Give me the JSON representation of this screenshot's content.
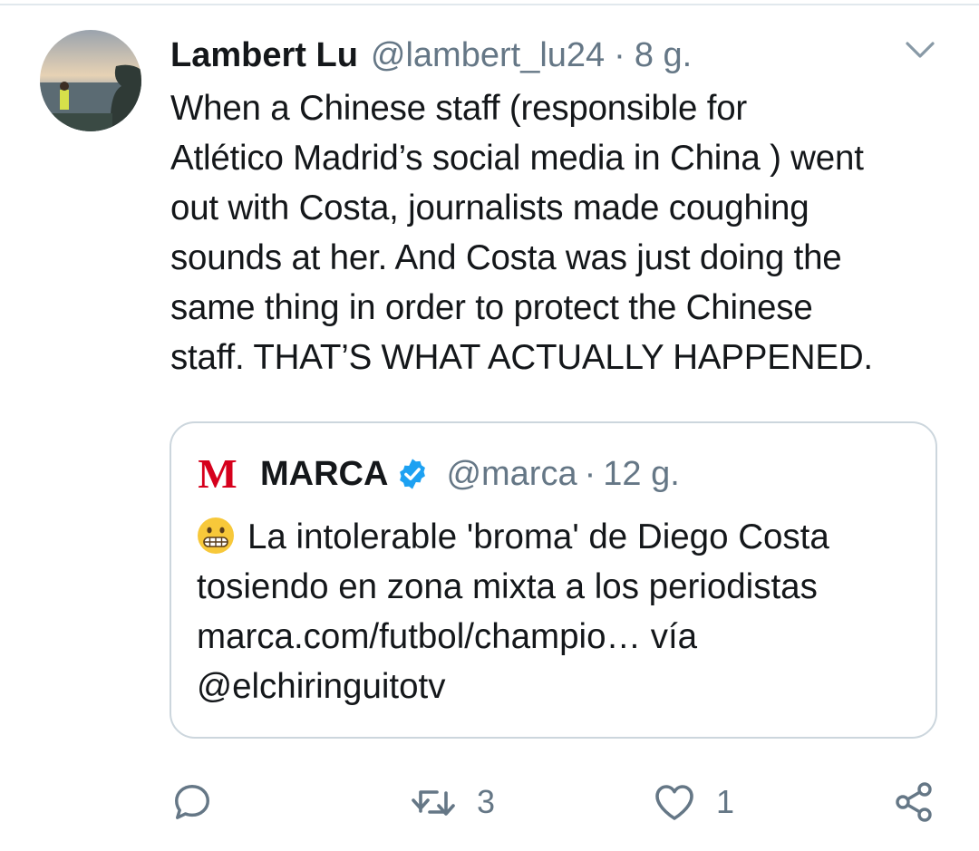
{
  "tweet": {
    "author_name": "Lambert Lu",
    "author_handle": "@lambert_lu24",
    "separator": "·",
    "time": "8 g.",
    "text_lines": [
      "When a Chinese staff (responsible for",
      "Atlético Madrid’s social media in China ) went",
      "out with Costa, journalists made coughing",
      "sounds at her. And Costa was just doing the",
      "same thing in order to protect the Chinese",
      "staff. THAT’S WHAT ACTUALLY HAPPENED."
    ]
  },
  "quote": {
    "logo_letter": "M",
    "author_name": "MARCA",
    "author_handle": "@marca",
    "separator": "·",
    "time": "12 g.",
    "text_lines": [
      "La intolerable 'broma' de Diego Costa",
      "tosiendo en zona mixta a los periodistas",
      "marca.com/futbol/champio…  vía",
      "@elchiringuitotv"
    ]
  },
  "actions": {
    "retweet_count": "3",
    "like_count": "1"
  },
  "colors": {
    "text": "#14171a",
    "secondary": "#657786",
    "border": "#ccd6dd",
    "verified": "#1da1f2",
    "marca_red": "#d6001c"
  },
  "icons": {
    "caret": "chevron-down-icon",
    "verified": "verified-badge-icon",
    "emoji": "grimacing-face-emoji",
    "reply": "reply-icon",
    "retweet": "retweet-icon",
    "like": "heart-icon",
    "share": "share-icon"
  }
}
